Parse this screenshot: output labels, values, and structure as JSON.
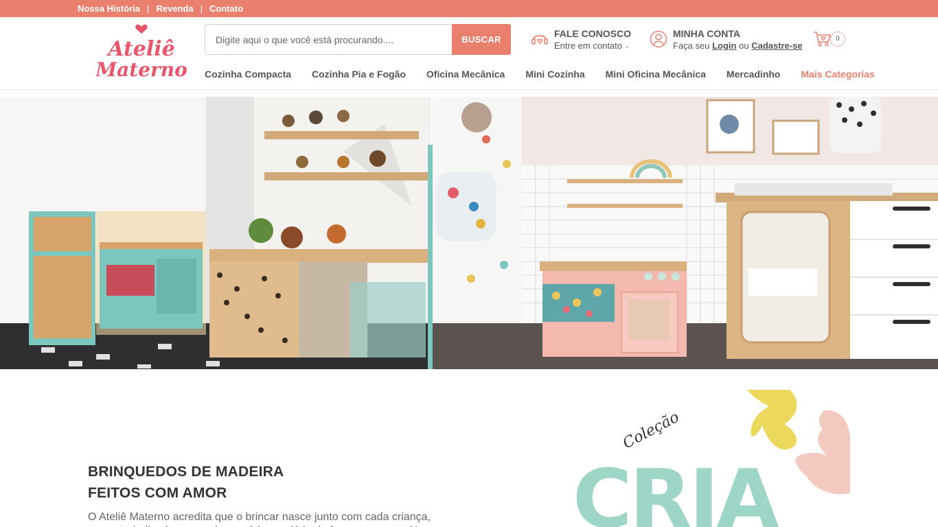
{
  "topbar": {
    "links": [
      "Nossa História",
      "Revenda",
      "Contato"
    ],
    "separator": "|"
  },
  "logo": {
    "line1": "Ateliê",
    "line2": "Materno"
  },
  "search": {
    "placeholder": "Digite aqui o que você está procurando....",
    "button": "BUSCAR"
  },
  "contact": {
    "title": "FALE CONOSCO",
    "subtitle": "Entre em contato",
    "icon": "headset-heart-icon"
  },
  "account": {
    "title": "MINHA CONTA",
    "prefix": "Faça seu",
    "login": "Login",
    "or": "ou",
    "signup": "Cadastre-se",
    "icon": "user-icon"
  },
  "cart": {
    "count": "0",
    "icon": "cart-heart-icon"
  },
  "nav": {
    "items": [
      "Cozinha Compacta",
      "Cozinha Pia e Fogão",
      "Oficina Mecânica",
      "Mini Cozinha",
      "Mini Oficina Mecânica",
      "Mercadinho",
      "Mais Categorias"
    ]
  },
  "hero": {
    "headline_line1": "BRINQUEDOS DE MADEIRA",
    "headline_line2": "FEITOS COM AMOR",
    "paragraph": "O Ateliê Materno acredita que o brincar nasce junto com cada criança, nosso trabalho é apenas despertá-lo e guiá-lo de forma amorosa. Nossos"
  },
  "collection": {
    "small": "Coleção",
    "big": "CRIA"
  },
  "colors": {
    "brand": "#e9806e",
    "text": "#555555",
    "mint": "#9dd5c6",
    "yellow": "#ecd95c",
    "pink": "#f4c9c0"
  }
}
